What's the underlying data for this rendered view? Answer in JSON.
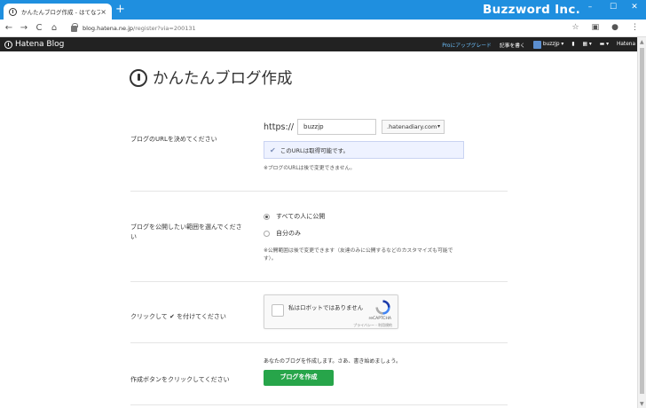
{
  "browser": {
    "tab_title": "かんたんブログ作成 - はてなブログ",
    "tab_close": "×",
    "new_tab": "+",
    "brand": "Buzzword Inc.",
    "win_min": "–",
    "win_max": "☐",
    "win_close": "✕",
    "url_host": "blog.hatena.ne.jp",
    "url_path": "/register?via=200131",
    "nav_back": "←",
    "nav_forward": "→",
    "nav_reload": "C",
    "nav_home": "⌂",
    "tool_star": "☆",
    "tool_ext": "▣",
    "tool_account": "●",
    "tool_menu": "⋮"
  },
  "hatena_bar": {
    "logo": "Hatena Blog",
    "pro_link": "Proにアップグレード",
    "write_link": "記事を書く",
    "user": "buzzjp ▾",
    "bookmark_glyph": "▮",
    "grid_glyph": "▦ ▾",
    "chat_glyph": "▬ ▾",
    "brand": "Hatena"
  },
  "page": {
    "title": "かんたんブログ作成",
    "url_section": {
      "label": "ブログのURLを決めてください",
      "scheme": "https://",
      "subdomain": "buzzjp",
      "domain": ".hatenadiary.com",
      "domain_arrow": "▾",
      "available_check": "✔",
      "available": "このURLは取得可能です。",
      "note": "※ブログのURLは後で変更できません。"
    },
    "visibility_section": {
      "label_line1": "ブログを公開したい範囲を選んでくださ",
      "label_line2": "い",
      "option_public": "すべての人に公開",
      "option_private": "自分のみ",
      "note_line1": "※公開範囲は後で変更できます（友達のみに公開するなどのカスタマイズも可能で",
      "note_line2": "す）。"
    },
    "captcha_section": {
      "label": "クリックして ✔ を付けてください",
      "captcha_text": "私はロボットではありません",
      "recaptcha": "reCAPTCHA",
      "links": "プライバシー - 利用規約"
    },
    "create_section": {
      "label": "作成ボタンをクリックしてください",
      "lead": "あなたのブログを作成します。さあ、書き始めましょう。",
      "button": "ブログを作成"
    }
  }
}
